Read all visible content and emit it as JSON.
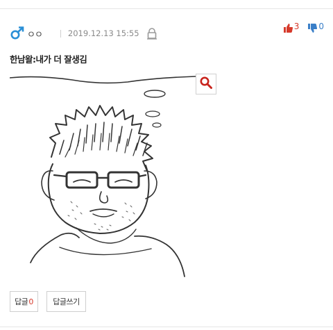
{
  "post": {
    "author": {
      "gender_icon": "male-sign-icon",
      "nickname": "ㅇㅇ"
    },
    "date": "2019.12.13 15:55",
    "lock_icon": "lock-icon",
    "title": "한남왈:내가 더 잘생김",
    "votes": {
      "up_count": "3",
      "down_count": "0"
    }
  },
  "image": {
    "zoom_icon": "magnifier-icon"
  },
  "actions": {
    "reply_label": "답글",
    "reply_count": "0",
    "write_reply_label": "답글쓰기"
  },
  "colors": {
    "accent_red": "#d63a2b",
    "accent_blue": "#2a8fd6",
    "down_blue": "#3a7fc8"
  }
}
